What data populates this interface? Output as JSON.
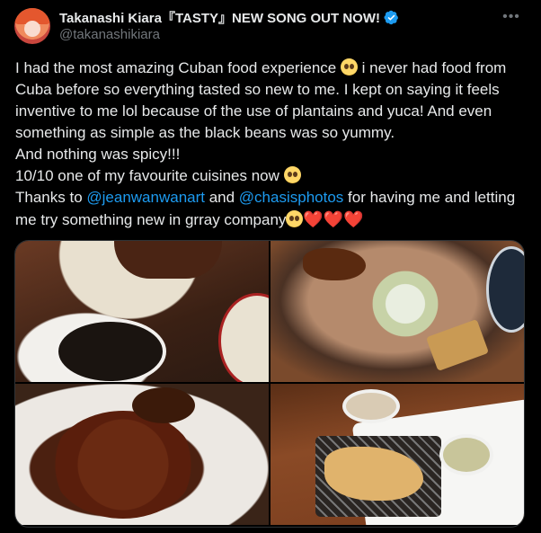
{
  "author": {
    "display_name": "Takanashi Kiara『TASTY』NEW SONG OUT NOW!",
    "handle": "@takanashikiara",
    "verified": true
  },
  "menu_icon": "more-horizontal-icon",
  "tweet": {
    "lines": [
      {
        "parts": [
          {
            "t": "I had the most amazing Cuban food experience "
          },
          {
            "emoji": "pleading"
          },
          {
            "t": " i never had food from Cuba before so everything tasted so new to me. I kept on saying it feels inventive to me lol because of the use of plantains and yuca! And even something as simple as the black beans was so yummy."
          }
        ]
      },
      {
        "parts": [
          {
            "t": "And nothing was spicy!!!"
          }
        ]
      },
      {
        "parts": [
          {
            "t": "10/10 one of my favourite cuisines now "
          },
          {
            "emoji": "pleading"
          }
        ]
      },
      {
        "parts": [
          {
            "t": "Thanks to "
          },
          {
            "mention": "@jeanwanwanart"
          },
          {
            "t": " and "
          },
          {
            "mention": "@chasisphotos"
          },
          {
            "t": " for having me and letting me try something new in grray company"
          },
          {
            "emoji": "pleading"
          },
          {
            "heart": "❤️"
          },
          {
            "heart": "❤️"
          },
          {
            "heart": "❤️"
          }
        ]
      }
    ]
  },
  "media": [
    {
      "name": "photo-steak-and-black-beans"
    },
    {
      "name": "photo-ropa-vieja-with-onions"
    },
    {
      "name": "photo-braised-beef-with-plantains"
    },
    {
      "name": "photo-fried-empanadas-in-basket"
    }
  ],
  "colors": {
    "mention": "#1d9bf0",
    "text": "#e7e9ea",
    "muted": "#71767b",
    "verified": "#1d9bf0",
    "background": "#000000"
  }
}
